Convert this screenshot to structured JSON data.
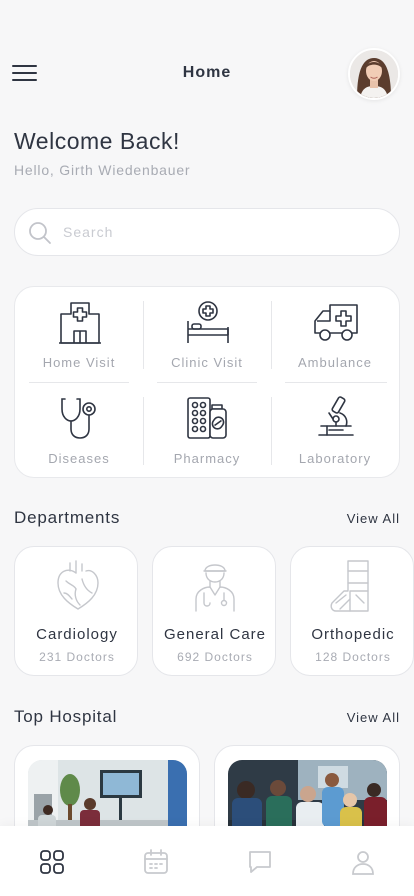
{
  "header": {
    "title": "Home"
  },
  "greeting": {
    "title": "Welcome Back!",
    "subtitle": "Hello, Girth Wiedenbauer"
  },
  "search": {
    "placeholder": "Search"
  },
  "services": [
    {
      "label": "Home Visit",
      "icon": "home-visit-icon"
    },
    {
      "label": "Clinic Visit",
      "icon": "clinic-visit-icon"
    },
    {
      "label": "Ambulance",
      "icon": "ambulance-icon"
    },
    {
      "label": "Diseases",
      "icon": "stethoscope-icon"
    },
    {
      "label": "Pharmacy",
      "icon": "pharmacy-icon"
    },
    {
      "label": "Laboratory",
      "icon": "microscope-icon"
    }
  ],
  "departments": {
    "title": "Departments",
    "view_all": "View All",
    "items": [
      {
        "name": "Cardiology",
        "count": "231 Doctors",
        "icon": "heart-icon"
      },
      {
        "name": "General Care",
        "count": "692 Doctors",
        "icon": "doctor-icon"
      },
      {
        "name": "Orthopedic",
        "count": "128 Doctors",
        "icon": "leg-cast-icon"
      }
    ]
  },
  "hospitals": {
    "title": "Top Hospital",
    "view_all": "View All"
  },
  "tabbar": [
    "grid-icon",
    "calendar-icon",
    "chat-icon",
    "profile-icon"
  ],
  "colors": {
    "text": "#2f3542",
    "muted": "#a8abb3",
    "icon": "#2f3542",
    "dept_icon": "#c5c7cc"
  }
}
